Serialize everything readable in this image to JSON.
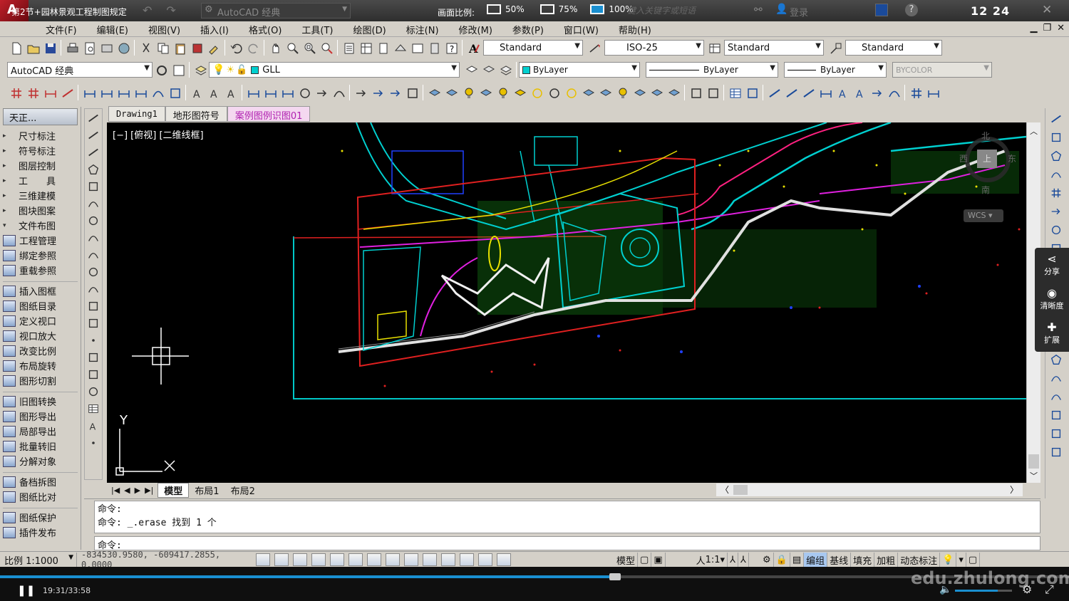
{
  "titlebar": {
    "title": "第2节+园林景观工程制图规定",
    "workspace": "AutoCAD 经典",
    "ratio_label": "画面比例:",
    "ratio_options": [
      "50%",
      "75%",
      "100%"
    ],
    "search_placeholder": "键入关键字或短语",
    "login": "登录",
    "clock": "12 24"
  },
  "menu": [
    "文件(F)",
    "编辑(E)",
    "视图(V)",
    "插入(I)",
    "格式(O)",
    "工具(T)",
    "绘图(D)",
    "标注(N)",
    "修改(M)",
    "参数(P)",
    "窗口(W)",
    "帮助(H)"
  ],
  "styles_toolbar": {
    "text_style": "Standard",
    "dim_style": "ISO-25",
    "table_style": "Standard",
    "multileader_style": "Standard"
  },
  "layers_toolbar": {
    "workspace": "AutoCAD 经典",
    "layer": "GLL",
    "color": "ByLayer",
    "linetype": "ByLayer",
    "lineweight": "ByLayer",
    "plotstyle": "BYCOLOR"
  },
  "sidebar": {
    "title": "天正...",
    "groups": [
      {
        "label": "尺寸标注",
        "expand": "▸"
      },
      {
        "label": "符号标注",
        "expand": "▸"
      },
      {
        "label": "图层控制",
        "expand": "▸"
      },
      {
        "label": "工　　具",
        "expand": "▸"
      },
      {
        "label": "三维建模",
        "expand": "▸"
      },
      {
        "label": "图块图案",
        "expand": "▸"
      },
      {
        "label": "文件布图",
        "expand": "▾"
      }
    ],
    "items": [
      "工程管理",
      "绑定参照",
      "重载参照",
      "插入图框",
      "图纸目录",
      "定义视口",
      "视口放大",
      "改变比例",
      "布局旋转",
      "图形切割",
      "旧图转换",
      "图形导出",
      "局部导出",
      "批量转旧",
      "分解对象",
      "备档拆图",
      "图纸比对",
      "图纸保护",
      "插件发布"
    ]
  },
  "tabs": [
    "Drawing1",
    "地形图符号",
    "案例图例识图01"
  ],
  "viewport_label": "[−] [俯视] [二维线框]",
  "compass": {
    "north": "北",
    "east": "东",
    "south": "南",
    "west": "西",
    "top": "上",
    "wcs": "WCS"
  },
  "layout_tabs": [
    "模型",
    "布局1",
    "布局2"
  ],
  "command": {
    "history": [
      "命令:",
      "命令: _.erase 找到 1 个"
    ],
    "prompt": "命令:"
  },
  "status": {
    "scale": "比例 1:1000",
    "coords": "-834530.9580, -609417.2855, 0.0000",
    "model": "模型",
    "annot_scale": "1:1",
    "buttons": [
      "编组",
      "基线",
      "填充",
      "加粗",
      "动态标注"
    ]
  },
  "right_float": {
    "share": "分享",
    "clarity": "清晰度",
    "extend": "扩展"
  },
  "player": {
    "time": "19:31/33:58",
    "progress": 0.575,
    "volume": 0.75
  },
  "watermark": "edu.zhulong.com",
  "axis": {
    "y": "Y",
    "x": "X"
  }
}
